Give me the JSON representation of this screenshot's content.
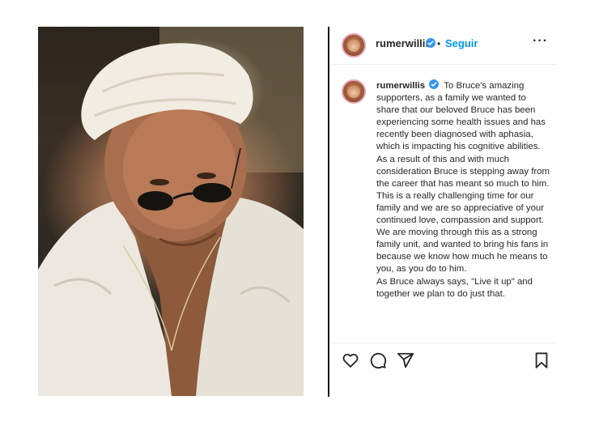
{
  "post": {
    "username": "rumerwillis",
    "follow_separator": "•",
    "follow_label": "Seguir",
    "more_label": "···",
    "caption": {
      "username": "rumerwillis",
      "paragraph_1": "To Bruce's amazing supporters, as a family we wanted to share that our beloved Bruce has been experiencing some health issues and has recently been diagnosed with aphasia, which is impacting his cognitive abilities. As a result of this and with much consideration Bruce is stepping away from the career that has meant so much to him.",
      "paragraph_2": "This is a really challenging time for our family and we are so appreciative of your continued love, compassion and support. We are moving through this as a strong family unit, and wanted to bring his fans in because we know how much he means to you, as you do to him.",
      "paragraph_3": "As Bruce always says, \"Live it up\" and together we plan to do just that."
    }
  },
  "colors": {
    "accent": "#0095f6",
    "verified": "#3897f0",
    "text": "#262626"
  },
  "icons": [
    "verified-badge-icon",
    "heart-icon",
    "comment-icon",
    "share-icon",
    "bookmark-icon"
  ]
}
